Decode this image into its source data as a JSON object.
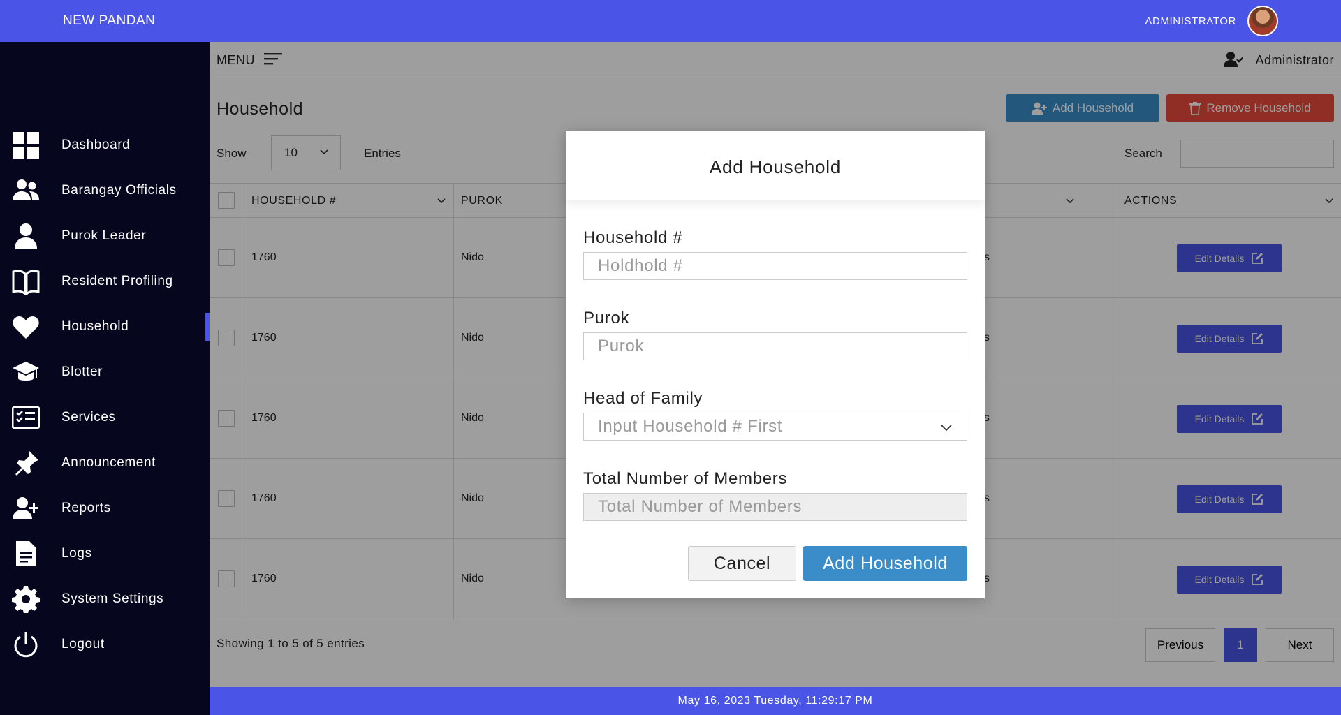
{
  "topbar": {
    "brand": "NEW PANDAN",
    "admin_label": "ADMINISTRATOR"
  },
  "sidebar": {
    "items": [
      {
        "label": "Dashboard",
        "icon": "grid-icon"
      },
      {
        "label": "Barangay Officials",
        "icon": "users-icon"
      },
      {
        "label": "Purok Leader",
        "icon": "user-icon"
      },
      {
        "label": "Resident Profiling",
        "icon": "book-icon"
      },
      {
        "label": "Household",
        "icon": "heart-icon",
        "active": true
      },
      {
        "label": "Blotter",
        "icon": "graduation-cap-icon"
      },
      {
        "label": "Services",
        "icon": "checklist-icon"
      },
      {
        "label": "Announcement",
        "icon": "pin-icon"
      },
      {
        "label": "Reports",
        "icon": "user-plus-icon"
      },
      {
        "label": "Logs",
        "icon": "document-icon"
      },
      {
        "label": "System Settings",
        "icon": "gear-icon"
      },
      {
        "label": "Logout",
        "icon": "power-icon"
      }
    ]
  },
  "menubar": {
    "menu_label": "MENU",
    "user_name": "Administrator"
  },
  "page": {
    "title": "Household",
    "add_button": "Add Household",
    "remove_button": "Remove Household",
    "show_label": "Show",
    "show_value": "10",
    "entries_label": "Entries",
    "search_label": "Search"
  },
  "table": {
    "headers": [
      "HOUSEHOLD #",
      "PUROK",
      "",
      "",
      "ACTIONS"
    ],
    "rows": [
      {
        "household": "1760",
        "purok": "Nido",
        "col4": "s",
        "action": "Edit Details"
      },
      {
        "household": "1760",
        "purok": "Nido",
        "col4": "s",
        "action": "Edit Details"
      },
      {
        "household": "1760",
        "purok": "Nido",
        "col4": "s",
        "action": "Edit Details"
      },
      {
        "household": "1760",
        "purok": "Nido",
        "col4": "s",
        "action": "Edit Details"
      },
      {
        "household": "1760",
        "purok": "Nido",
        "col4": "s",
        "action": "Edit Details"
      }
    ],
    "showing": "Showing 1 to 5 of 5 entries",
    "pager": {
      "previous": "Previous",
      "page": "1",
      "next": "Next"
    }
  },
  "footer": {
    "datetime": "May 16, 2023 Tuesday, 11:29:17 PM"
  },
  "modal": {
    "title": "Add Household",
    "fields": [
      {
        "label": "Household #",
        "placeholder": "Holdhold #"
      },
      {
        "label": "Purok",
        "placeholder": "Purok"
      },
      {
        "label": "Head of Family",
        "placeholder": "Input Household # First"
      },
      {
        "label": "Total Number of Members",
        "placeholder": "Total Number of Members"
      }
    ],
    "cancel": "Cancel",
    "submit": "Add Household"
  }
}
